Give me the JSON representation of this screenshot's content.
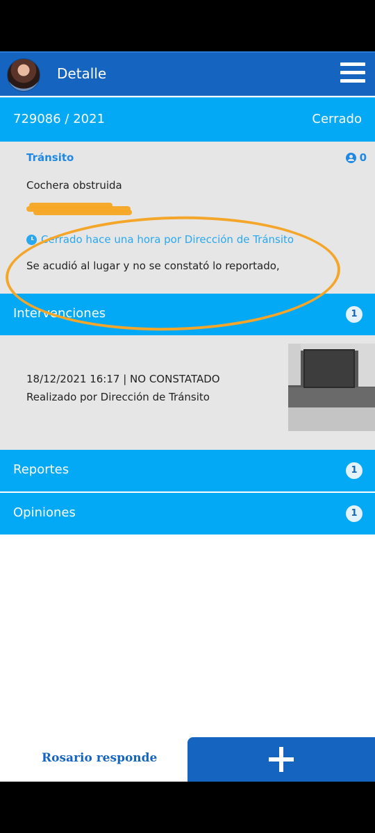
{
  "appbar": {
    "title": "Detalle",
    "avatar_icon": "profile-photo",
    "menu_icon": "hamburger-icon"
  },
  "case": {
    "number": "729086 / 2021",
    "status": "Cerrado"
  },
  "detail": {
    "category": "Tránsito",
    "followers_count": "0",
    "subject": "Cochera obstruida",
    "closed_info": "Cerrado hace una hora por Dirección de Tránsito",
    "description": "Se acudió al lugar y no se constató lo reportado,"
  },
  "sections": {
    "intervenciones": {
      "label": "Intervenciones",
      "count": "1"
    },
    "reportes": {
      "label": "Reportes",
      "count": "1"
    },
    "opiniones": {
      "label": "Opiniones",
      "count": "1"
    }
  },
  "intervention": {
    "line1": "18/12/2021 16:17 | NO CONSTATADO",
    "line2": "Realizado por Dirección de Tránsito"
  },
  "footer": {
    "brand_link": "Rosario responde",
    "add_icon": "plus-icon"
  },
  "colors": {
    "appbar": "#1565c0",
    "section": "#03a9f4",
    "card": "#e6e6e6",
    "annotation": "#f4a62a"
  }
}
